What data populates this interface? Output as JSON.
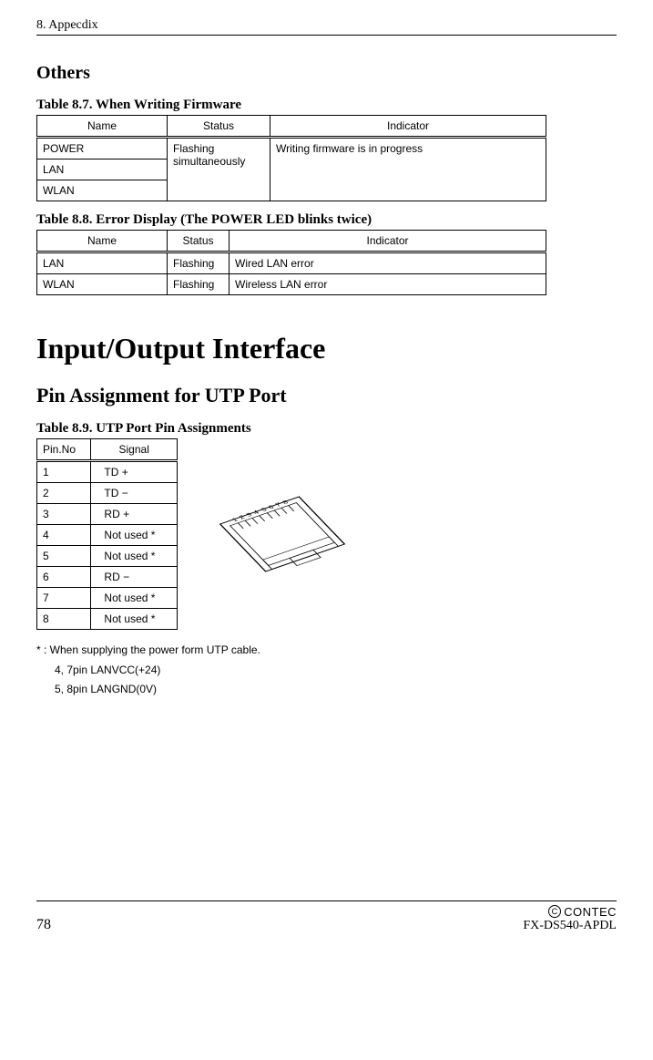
{
  "header": {
    "chapter": "8. Appecdix"
  },
  "others": {
    "title": "Others",
    "t87": {
      "caption": "Table 8.7.  When Writing Firmware",
      "headers": [
        "Name",
        "Status",
        "Indicator"
      ],
      "status": "Flashing simultaneously",
      "indicator": "Writing firmware is in progress",
      "rows": [
        "POWER",
        "LAN",
        "WLAN"
      ]
    },
    "t88": {
      "caption": "Table 8.8.  Error Display (The POWER LED blinks twice)",
      "headers": [
        "Name",
        "Status",
        "Indicator"
      ],
      "rows": [
        {
          "name": "LAN",
          "status": "Flashing",
          "indicator": "Wired LAN error"
        },
        {
          "name": "WLAN",
          "status": "Flashing",
          "indicator": "Wireless LAN error"
        }
      ]
    }
  },
  "io": {
    "title": "Input/Output Interface",
    "subtitle": "Pin Assignment for UTP Port",
    "t89": {
      "caption": "Table 8.9.  UTP Port Pin Assignments",
      "headers": [
        "Pin.No",
        "Signal"
      ],
      "rows": [
        {
          "pin": "1",
          "signal": "TD +"
        },
        {
          "pin": "2",
          "signal": "TD −"
        },
        {
          "pin": "3",
          "signal": "RD +"
        },
        {
          "pin": "4",
          "signal": "Not used *"
        },
        {
          "pin": "5",
          "signal": "Not used *"
        },
        {
          "pin": "6",
          "signal": "RD −"
        },
        {
          "pin": "7",
          "signal": "Not used *"
        },
        {
          "pin": "8",
          "signal": "Not used *"
        }
      ]
    },
    "footnote": {
      "star": "* : When supplying the power form UTP cable.",
      "line1": "4, 7pin  LANVCC(+24)",
      "line2": "5, 8pin  LANGND(0V)"
    }
  },
  "footer": {
    "page": "78",
    "brand": "CONTEC",
    "copyright": "©",
    "model": "FX-DS540-APDL"
  }
}
